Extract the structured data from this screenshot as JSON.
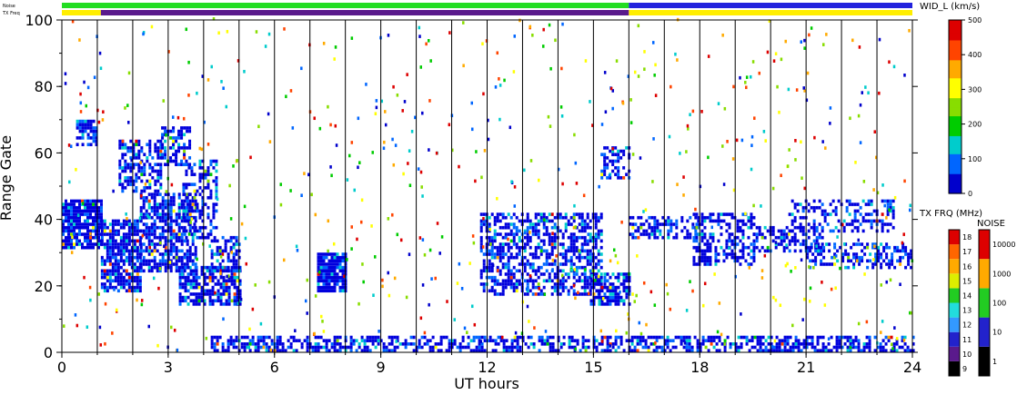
{
  "chart_data": {
    "type": "heatmap",
    "xlabel": "UT hours",
    "ylabel": "Range Gate",
    "xlim": [
      0,
      24
    ],
    "ylim": [
      0,
      100
    ],
    "x_ticks": [
      "0",
      "3",
      "6",
      "9",
      "12",
      "15",
      "18",
      "21",
      "24"
    ],
    "y_ticks": [
      "0",
      "20",
      "40",
      "60",
      "80",
      "100"
    ],
    "status_bars": [
      {
        "label": "Noise",
        "segments": [
          {
            "from": 0,
            "to": 16,
            "color": "#22dd22"
          },
          {
            "from": 16,
            "to": 24,
            "color": "#2222dd"
          }
        ]
      },
      {
        "label": "TX Freq",
        "segments": [
          {
            "from": 0,
            "to": 1.1,
            "color": "#ffee00"
          },
          {
            "from": 1.1,
            "to": 16,
            "color": "#5a1a8c"
          },
          {
            "from": 16,
            "to": 24,
            "color": "#ffee00"
          }
        ]
      }
    ],
    "wid_scale": {
      "title": "WID_L (km/s)",
      "ticks": [
        "0",
        "100",
        "200",
        "300",
        "400",
        "500"
      ],
      "range": [
        0,
        500
      ],
      "gradient": [
        "#0000cc",
        "#0066ff",
        "#00cccc",
        "#00cc00",
        "#88dd00",
        "#ffff00",
        "#ffaa00",
        "#ff4400",
        "#dd0000"
      ]
    },
    "txfreq_scale": {
      "title": "TX FRQ (MHz)",
      "labels": [
        "9",
        "10",
        "11",
        "12",
        "13",
        "14",
        "15",
        "16",
        "17",
        "18"
      ],
      "colors": [
        "#000000",
        "#5a1a8c",
        "#2222cc",
        "#3399ff",
        "#22dddd",
        "#22cc22",
        "#ddee00",
        "#ffaa00",
        "#ff6600",
        "#dd0000"
      ]
    },
    "noise_scale": {
      "title": "NOISE",
      "labels": [
        "1",
        "10",
        "100",
        "1000",
        "10000"
      ],
      "colors": [
        "#000000",
        "#2222cc",
        "#22cc22",
        "#ffaa00",
        "#dd0000"
      ]
    },
    "scatter_regions": [
      {
        "x": [
          0.0,
          1.1
        ],
        "y": [
          31,
          46
        ],
        "density": 0.85
      },
      {
        "x": [
          0.4,
          1.0
        ],
        "y": [
          62,
          70
        ],
        "density": 0.6
      },
      {
        "x": [
          1.1,
          2.2
        ],
        "y": [
          18,
          40
        ],
        "density": 0.75
      },
      {
        "x": [
          1.6,
          2.8
        ],
        "y": [
          48,
          64
        ],
        "density": 0.55
      },
      {
        "x": [
          2.2,
          3.8
        ],
        "y": [
          24,
          48
        ],
        "density": 0.7
      },
      {
        "x": [
          2.8,
          3.6
        ],
        "y": [
          56,
          68
        ],
        "density": 0.6
      },
      {
        "x": [
          3.4,
          4.4
        ],
        "y": [
          34,
          58
        ],
        "density": 0.45
      },
      {
        "x": [
          3.3,
          5.0
        ],
        "y": [
          14,
          26
        ],
        "density": 0.7
      },
      {
        "x": [
          4.2,
          5.0
        ],
        "y": [
          24,
          35
        ],
        "density": 0.5
      },
      {
        "x": [
          7.2,
          8.0
        ],
        "y": [
          18,
          30
        ],
        "density": 0.9
      },
      {
        "x": [
          11.8,
          15.2
        ],
        "y": [
          17,
          42
        ],
        "density": 0.55
      },
      {
        "x": [
          14.9,
          16.0
        ],
        "y": [
          14,
          24
        ],
        "density": 0.75
      },
      {
        "x": [
          15.2,
          16.0
        ],
        "y": [
          52,
          62
        ],
        "density": 0.5
      },
      {
        "x": [
          16.0,
          18.0
        ],
        "y": [
          34,
          41
        ],
        "density": 0.5
      },
      {
        "x": [
          17.8,
          19.5
        ],
        "y": [
          26,
          42
        ],
        "density": 0.45
      },
      {
        "x": [
          19.5,
          21.5
        ],
        "y": [
          30,
          38
        ],
        "density": 0.45
      },
      {
        "x": [
          21.0,
          24.0
        ],
        "y": [
          25,
          33
        ],
        "density": 0.5
      },
      {
        "x": [
          20.5,
          23.5
        ],
        "y": [
          36,
          46
        ],
        "density": 0.4
      },
      {
        "x": [
          4.2,
          24.0
        ],
        "y": [
          0,
          5
        ],
        "density": 0.55
      }
    ]
  }
}
